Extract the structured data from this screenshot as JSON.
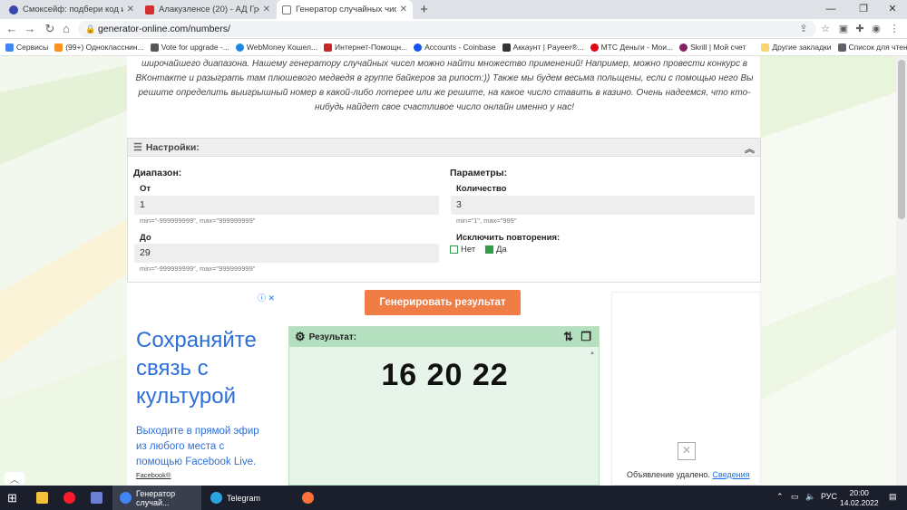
{
  "browser": {
    "tabs": [
      {
        "title": "Смоксейф: подбери код и полу",
        "icon_color": "#3949ab"
      },
      {
        "title": "Алакузленсе (20) - АД Гресия",
        "icon_color": "#d32f2f"
      },
      {
        "title": "Генератор случайных чисел он",
        "icon_color": "#5f6368"
      }
    ],
    "new_tab": "+",
    "url": "generator-online.com/numbers/",
    "bookmarks": [
      {
        "label": "Сервисы",
        "color": "#4285f4"
      },
      {
        "label": "(99+) Однокласснин...",
        "color": "#f7931e"
      },
      {
        "label": "Vote for upgrade -...",
        "color": "#555555"
      },
      {
        "label": "WebMoney Кошел...",
        "color": "#1e88e5"
      },
      {
        "label": "Интернет-Помощн...",
        "color": "#c62828"
      },
      {
        "label": "Accounts - Coinbase",
        "color": "#1652f0"
      },
      {
        "label": "Аккаунт | Payeer®...",
        "color": "#333333"
      },
      {
        "label": "МТС Деньги - Мои...",
        "color": "#e30611"
      },
      {
        "label": "Skrill | Мой счет",
        "color": "#862165"
      },
      {
        "label": "Другие закладки",
        "color": "#f9d56e"
      },
      {
        "label": "Список для чтения",
        "color": "#5f6368"
      }
    ]
  },
  "page": {
    "intro": "широчайшего диапазона. Нашему генератору случайных чисел можно найти множество применений! Например, можно провести конкурс в ВКонтакте и разыграть там плюшевого медведя в группе байкеров за рипост:)) Также мы будем весьма польщены, если с помощью него Вы решите определить выигрышный номер в какой-либо лотерее или же решите, на какое число ставить в казино. Очень надеемся, что кто-нибудь найдет свое счастливое число онлайн именно у нас!",
    "settings": {
      "title": "Настройки:",
      "range_title": "Диапазон:",
      "from_label": "От",
      "from_value": "1",
      "from_hint": "min=\"-999999999\", max=\"999999999\"",
      "to_label": "До",
      "to_value": "29",
      "to_hint": "min=\"-999999999\", max=\"999999999\"",
      "params_title": "Параметры:",
      "count_label": "Количество",
      "count_value": "3",
      "count_hint": "min=\"1\", max=\"999\"",
      "exclude_label": "Исключить повторения:",
      "no_label": "Нет",
      "yes_label": "Да"
    },
    "generate_button": "Генерировать результат",
    "result": {
      "title": "Результат:",
      "value": "16 20 22"
    },
    "ad_left": {
      "headline": "Сохраняйте связь с культурой",
      "subtext": "Выходите в прямой эфир из любого места с помощью Facebook Live.",
      "brand": "Facebook®"
    },
    "ad_right": {
      "removed_text": "Объявление удалено.",
      "details_link": "Сведения"
    }
  },
  "taskbar": {
    "apps": [
      {
        "label": "Генератор случай...",
        "color": "#4285f4"
      },
      {
        "label": "Telegram",
        "color": "#2aa3e0"
      }
    ],
    "lang": "РУС",
    "time": "20:00",
    "date": "14.02.2022"
  }
}
